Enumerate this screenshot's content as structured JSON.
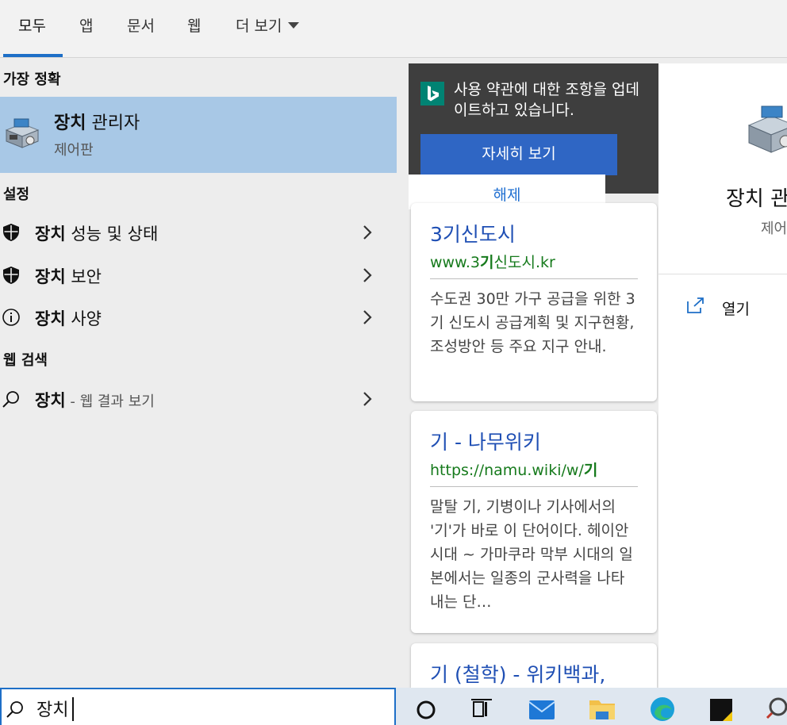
{
  "tabs": [
    {
      "label": "모두"
    },
    {
      "label": "앱"
    },
    {
      "label": "문서"
    },
    {
      "label": "웹"
    },
    {
      "label": "더 보기"
    }
  ],
  "sections": {
    "best_match": "가장 정확",
    "settings": "설정",
    "web_search": "웹 검색"
  },
  "best_match": {
    "title_bold": "장치",
    "title_rest": " 관리자",
    "subtitle": "제어판",
    "icon": "device-manager-icon"
  },
  "settings_items": [
    {
      "bold": "장치",
      "rest": " 성능 및 상태",
      "icon": "shield-icon"
    },
    {
      "bold": "장치",
      "rest": " 보안",
      "icon": "shield-icon"
    },
    {
      "bold": "장치",
      "rest": " 사양",
      "icon": "info-icon"
    }
  ],
  "web_item": {
    "bold": "장치",
    "rest": " - 웹 결과 보기",
    "icon": "search-icon"
  },
  "promo": {
    "text": "사용 약관에 대한 조항을 업데이트하고 있습니다.",
    "button": "자세히 보기",
    "dismiss": "해제"
  },
  "cards": [
    {
      "title": "3기신도시",
      "url_pre": "www.3",
      "url_bold": "기",
      "url_post": "신도시.kr",
      "snippet": "수도권 30만 가구 공급을 위한 3기 신도시 공급계획 및 지구현황, 조성방안 등 주요 지구 안내."
    },
    {
      "title": "기 - 나무위키",
      "url_pre": "https://namu.wiki/w/",
      "url_bold": "기",
      "url_post": "",
      "snippet": "말탈 기, 기병이나 기사에서의 '기'가 바로 이 단어이다. 헤이안 시대 ~ 가마쿠라 막부 시대의 일본에서는 일종의 군사력을 나타내는 단…"
    },
    {
      "title": "기 (철학) - 위키백과,",
      "url_pre": "",
      "url_bold": "",
      "url_post": "",
      "snippet": ""
    }
  ],
  "preview": {
    "title": "장치 관",
    "subtitle": "제어",
    "open_label": "열기",
    "open_icon": "open-external-icon"
  },
  "search": {
    "value": "장치"
  },
  "taskbar": [
    {
      "icon": "cortana-icon"
    },
    {
      "icon": "task-view-icon"
    },
    {
      "icon": "mail-icon"
    },
    {
      "icon": "file-explorer-icon"
    },
    {
      "icon": "edge-icon"
    },
    {
      "icon": "sticky-notes-icon"
    },
    {
      "icon": "app-icon"
    }
  ],
  "colors": {
    "accent": "#1e6fc7",
    "selected": "#a8c8e6",
    "link": "#1f4fb4",
    "url": "#167a1c",
    "promo_bg": "#3e3e3e",
    "bing": "#008373"
  }
}
